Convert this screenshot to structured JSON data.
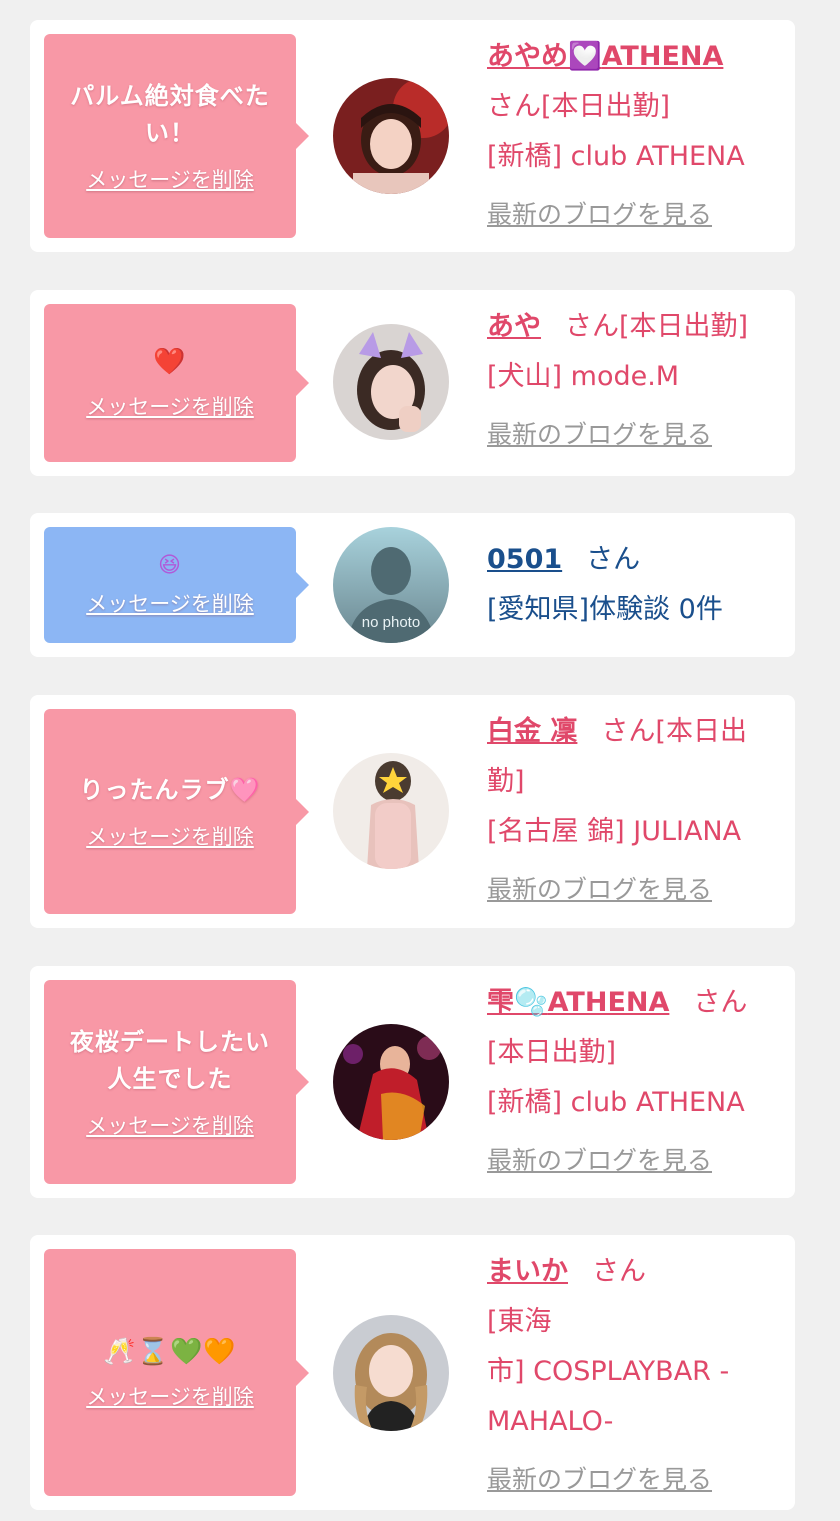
{
  "delete_label": "メッセージを削除",
  "blog_label": "最新のブログを見る",
  "san": "さん",
  "cards": [
    {
      "message": "パルム絶対食べたい！",
      "name_pre": "あやめ",
      "name_icon": "💟",
      "name_post": "ATHENA",
      "status": "さん[本日出勤]",
      "shop": "[新橋] club ATHENA"
    },
    {
      "message": "❤️",
      "name": "あや",
      "status": "さん[本日出勤]",
      "shop": "[犬山] mode.M"
    },
    {
      "message": "😆",
      "name": "0501",
      "san": "さん",
      "review": "[愛知県]体験談 0件",
      "no_photo": "no photo"
    },
    {
      "message": "りったんラブ🩷",
      "name": "白金 凜",
      "status_line1": "さん[本日出",
      "status_line2": "勤]",
      "shop": "[名古屋 錦] JULIANA"
    },
    {
      "message_line1": "夜桜デートしたい",
      "message_line2": "人生でした",
      "name_pre": "雫",
      "name_icon": "🫧",
      "name_post": "ATHENA",
      "san": "さん",
      "status": "[本日出勤]",
      "shop": "[新橋] club ATHENA"
    },
    {
      "message": "🥂⌛💚🧡",
      "name": "まいか",
      "san": "さん",
      "shop_line1": "[東海",
      "shop_line2": "市] COSPLAYBAR -",
      "shop_line3": "MAHALO-"
    }
  ]
}
